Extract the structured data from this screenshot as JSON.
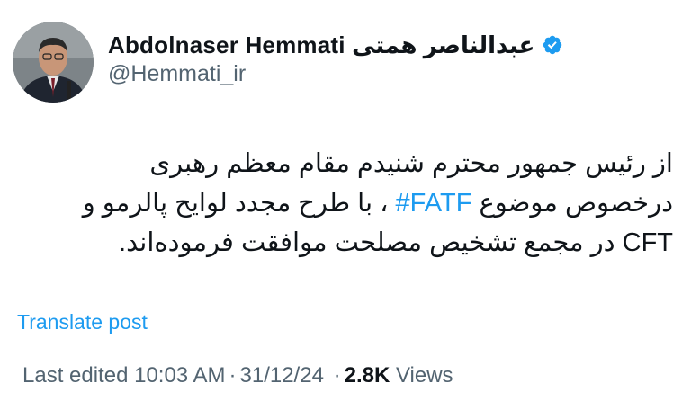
{
  "author": {
    "display_name": "Abdolnaser Hemmati عبدالناصر همتی",
    "handle": "@Hemmati_ir",
    "verified": true,
    "avatar_icon": "profile-photo"
  },
  "tweet": {
    "line1": "از رئیس جمهور محترم شنیدم مقام معظم رهبری",
    "line2_before": "درخصوص موضوع ",
    "hashtag": "#FATF",
    "line2_after": " ، با طرح مجدد لوایح پالرمو و",
    "line3": "CFT در مجمع تشخیص مصلحت موافقت فرموده‌اند."
  },
  "translate_label": "Translate post",
  "meta": {
    "edited_label": "Last edited",
    "time": "10:03 AM",
    "separator": "·",
    "date": "31/12/24",
    "views_count": "2.8K",
    "views_label": "Views"
  },
  "colors": {
    "link": "#1d9bf0",
    "secondary_text": "#536471",
    "primary_text": "#0f1419"
  }
}
